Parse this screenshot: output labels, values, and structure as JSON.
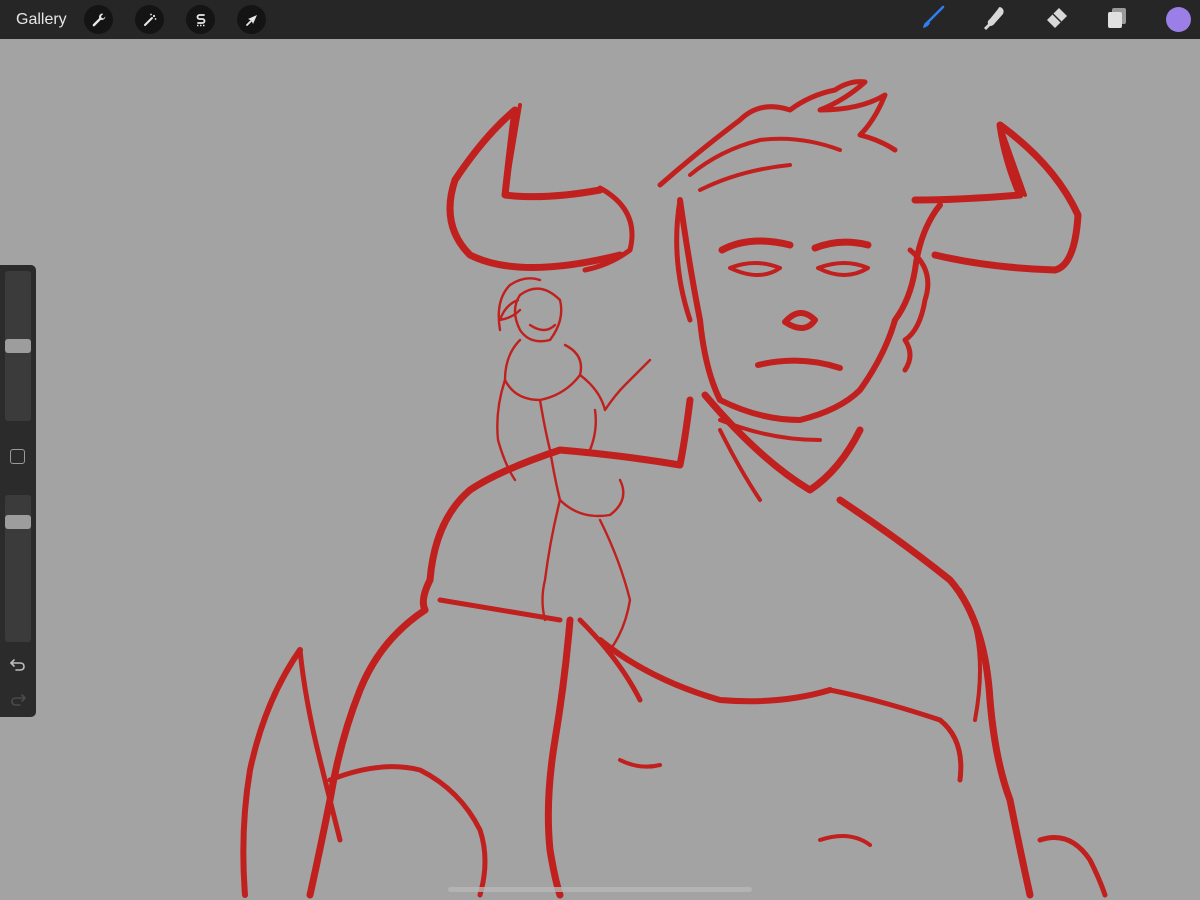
{
  "topbar": {
    "gallery_label": "Gallery",
    "left_tools": [
      {
        "name": "actions",
        "icon": "wrench-icon"
      },
      {
        "name": "adjustments",
        "icon": "magic-wand-icon"
      },
      {
        "name": "selection",
        "icon": "selection-s-icon"
      },
      {
        "name": "transform",
        "icon": "arrow-cursor-icon"
      }
    ],
    "right_tools": [
      {
        "name": "brush",
        "icon": "brush-icon",
        "active": true
      },
      {
        "name": "smudge",
        "icon": "smudge-finger-icon",
        "active": false
      },
      {
        "name": "eraser",
        "icon": "eraser-icon",
        "active": false
      },
      {
        "name": "layers",
        "icon": "layers-icon",
        "active": false
      }
    ],
    "current_color": "#9b7fe6"
  },
  "sidebar": {
    "brush_size_level": 0.5,
    "opacity_level": 0.85,
    "undo_icon": "undo-icon",
    "redo_icon": "redo-icon",
    "modify_icon": "square-modify-icon"
  },
  "canvas": {
    "background_color": "#a3a3a3",
    "stroke_color": "#c0201e"
  }
}
